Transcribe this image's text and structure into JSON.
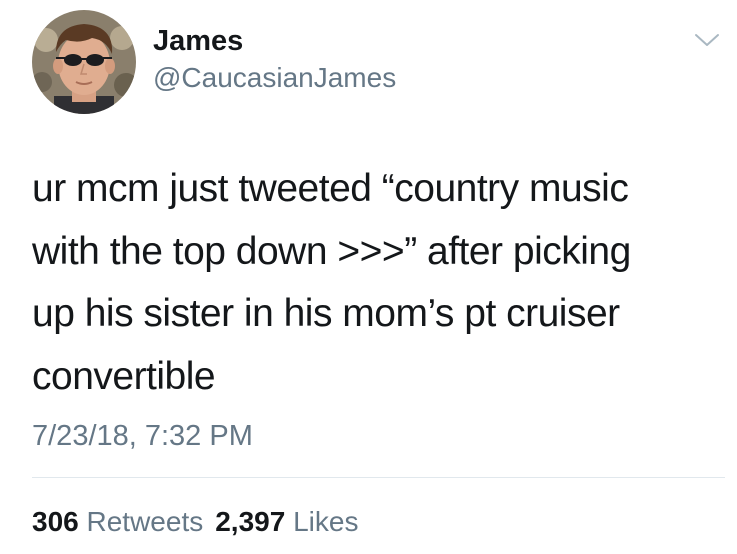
{
  "user": {
    "name": "James",
    "handle": "@CaucasianJames"
  },
  "tweet": {
    "lines": [
      "ur mcm just tweeted “country music",
      "with the top down >>>” after picking",
      "up his sister in his mom’s pt cruiser",
      "convertible"
    ],
    "timestamp": "7/23/18, 7:32 PM"
  },
  "stats": {
    "retweets_count": "306",
    "retweets_label": "Retweets",
    "likes_count": "2,397",
    "likes_label": "Likes"
  },
  "icons": {
    "menu": "chevron-down-icon",
    "avatar": "profile-photo"
  },
  "colors": {
    "text": "#14171a",
    "secondary": "#657786",
    "divider": "#e1e8ed"
  }
}
